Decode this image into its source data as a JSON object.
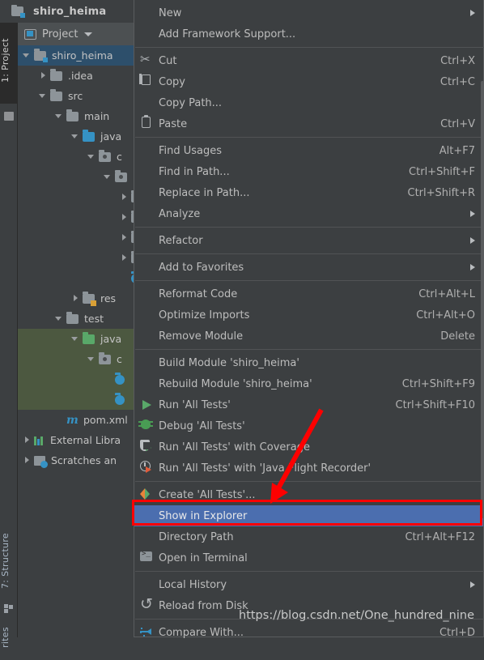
{
  "window": {
    "project_name": "shiro_heima",
    "project_icon": "module-folder-icon"
  },
  "toolstrip": {
    "tabs": [
      {
        "label": "1: Project",
        "active": true
      },
      {
        "label": "7: Structure",
        "active": false
      },
      {
        "label": "Favorites",
        "label_visible": "rites",
        "active": false
      }
    ]
  },
  "project_panel": {
    "header_label": "Project",
    "header_icon": "project-view-icon",
    "caret_icon": "chevron-down-icon",
    "tree": [
      {
        "label": "shiro_heima",
        "indent": 0,
        "twisty": "open",
        "icon": "module-folder-icon",
        "state": "selected-blue"
      },
      {
        "label": ".idea",
        "indent": 1,
        "twisty": "closed",
        "icon": "folder-icon",
        "state": ""
      },
      {
        "label": "src",
        "indent": 1,
        "twisty": "open",
        "icon": "folder-icon",
        "state": ""
      },
      {
        "label": "main",
        "indent": 2,
        "twisty": "open",
        "icon": "folder-icon",
        "state": ""
      },
      {
        "label": "java",
        "indent": 3,
        "twisty": "open",
        "icon": "source-folder-icon",
        "state": ""
      },
      {
        "label": "c",
        "indent": 4,
        "twisty": "open",
        "icon": "package-icon",
        "state": ""
      },
      {
        "label": "",
        "indent": 5,
        "twisty": "open",
        "icon": "package-icon",
        "state": ""
      },
      {
        "label": "",
        "indent": 6,
        "twisty": "closed",
        "icon": "package-icon",
        "state": ""
      },
      {
        "label": "",
        "indent": 6,
        "twisty": "closed",
        "icon": "package-icon",
        "state": ""
      },
      {
        "label": "",
        "indent": 6,
        "twisty": "closed",
        "icon": "package-icon",
        "state": ""
      },
      {
        "label": "",
        "indent": 6,
        "twisty": "closed",
        "icon": "package-icon",
        "state": ""
      },
      {
        "label": "",
        "indent": 6,
        "twisty": "none",
        "icon": "class-icon",
        "state": ""
      },
      {
        "label": "res",
        "indent": 3,
        "twisty": "closed",
        "icon": "resource-folder-icon",
        "state": ""
      },
      {
        "label": "test",
        "indent": 2,
        "twisty": "open",
        "icon": "folder-icon",
        "state": ""
      },
      {
        "label": "java",
        "indent": 3,
        "twisty": "open",
        "icon": "test-source-folder-icon",
        "state": "selected-green"
      },
      {
        "label": "c",
        "indent": 4,
        "twisty": "open",
        "icon": "package-icon",
        "state": "selected-green"
      },
      {
        "label": "",
        "indent": 5,
        "twisty": "none",
        "icon": "class-icon",
        "state": "selected-green"
      },
      {
        "label": "",
        "indent": 5,
        "twisty": "none",
        "icon": "class-icon",
        "state": "selected-green"
      },
      {
        "label": "pom.xml",
        "indent": 2,
        "twisty": "none",
        "icon": "maven-icon",
        "state": ""
      },
      {
        "label": "External Libra",
        "indent": 0,
        "twisty": "closed",
        "icon": "libraries-icon",
        "state": ""
      },
      {
        "label": "Scratches an",
        "indent": 0,
        "twisty": "closed",
        "icon": "scratches-icon",
        "state": ""
      }
    ]
  },
  "context_menu": {
    "items": [
      {
        "label": "New",
        "icon": "",
        "shortcut": "",
        "submenu": true,
        "highlighted": false,
        "mnemonic": "N"
      },
      {
        "label": "Add Framework Support...",
        "icon": "",
        "shortcut": "",
        "submenu": false,
        "highlighted": false
      },
      {
        "separator_after": true
      },
      {
        "label": "Cut",
        "icon": "cut-icon",
        "shortcut": "Ctrl+X",
        "submenu": false,
        "highlighted": false,
        "mnemonic": "t"
      },
      {
        "label": "Copy",
        "icon": "copy-icon",
        "shortcut": "Ctrl+C",
        "submenu": false,
        "highlighted": false,
        "mnemonic": "C"
      },
      {
        "label": "Copy Path...",
        "icon": "",
        "shortcut": "",
        "submenu": false,
        "highlighted": false
      },
      {
        "label": "Paste",
        "icon": "paste-icon",
        "shortcut": "Ctrl+V",
        "submenu": false,
        "highlighted": false,
        "mnemonic": "P"
      },
      {
        "separator_after": true
      },
      {
        "label": "Find Usages",
        "icon": "",
        "shortcut": "Alt+F7",
        "submenu": false,
        "highlighted": false,
        "mnemonic": "U"
      },
      {
        "label": "Find in Path...",
        "icon": "",
        "shortcut": "Ctrl+Shift+F",
        "submenu": false,
        "highlighted": false,
        "mnemonic": "P"
      },
      {
        "label": "Replace in Path...",
        "icon": "",
        "shortcut": "Ctrl+Shift+R",
        "submenu": false,
        "highlighted": false,
        "mnemonic": "a"
      },
      {
        "label": "Analyze",
        "icon": "",
        "shortcut": "",
        "submenu": true,
        "highlighted": false,
        "mnemonic": "z"
      },
      {
        "separator_after": true
      },
      {
        "label": "Refactor",
        "icon": "",
        "shortcut": "",
        "submenu": true,
        "highlighted": false,
        "mnemonic": "R"
      },
      {
        "separator_after": true
      },
      {
        "label": "Add to Favorites",
        "icon": "",
        "shortcut": "",
        "submenu": true,
        "highlighted": false,
        "mnemonic": "F"
      },
      {
        "separator_after": true
      },
      {
        "label": "Reformat Code",
        "icon": "",
        "shortcut": "Ctrl+Alt+L",
        "submenu": false,
        "highlighted": false,
        "mnemonic": "R"
      },
      {
        "label": "Optimize Imports",
        "icon": "",
        "shortcut": "Ctrl+Alt+O",
        "submenu": false,
        "highlighted": false,
        "mnemonic": "z"
      },
      {
        "label": "Remove Module",
        "icon": "",
        "shortcut": "Delete",
        "submenu": false,
        "highlighted": false
      },
      {
        "separator_after": true
      },
      {
        "label": "Build Module 'shiro_heima'",
        "icon": "",
        "shortcut": "",
        "submenu": false,
        "highlighted": false,
        "mnemonic": "M"
      },
      {
        "label": "Rebuild Module 'shiro_heima'",
        "icon": "",
        "shortcut": "Ctrl+Shift+F9",
        "submenu": false,
        "highlighted": false,
        "mnemonic": "e"
      },
      {
        "label": "Run 'All Tests'",
        "icon": "run-icon",
        "shortcut": "Ctrl+Shift+F10",
        "submenu": false,
        "highlighted": false,
        "mnemonic": "u"
      },
      {
        "label": "Debug 'All Tests'",
        "icon": "debug-icon",
        "shortcut": "",
        "submenu": false,
        "highlighted": false,
        "mnemonic": "D"
      },
      {
        "label": "Run 'All Tests' with Coverage",
        "icon": "coverage-icon",
        "shortcut": "",
        "submenu": false,
        "highlighted": false,
        "mnemonic": "v"
      },
      {
        "label": "Run 'All Tests' with 'Java Flight Recorder'",
        "icon": "jfr-icon",
        "shortcut": "",
        "submenu": false,
        "highlighted": false
      },
      {
        "separator_after": true
      },
      {
        "label": "Create 'All Tests'...",
        "icon": "create-test-icon",
        "shortcut": "",
        "submenu": false,
        "highlighted": false
      },
      {
        "label": "Show in Explorer",
        "icon": "",
        "shortcut": "",
        "submenu": false,
        "highlighted": true
      },
      {
        "label": "Directory Path",
        "icon": "",
        "shortcut": "Ctrl+Alt+F12",
        "submenu": false,
        "highlighted": false,
        "mnemonic": "a"
      },
      {
        "label": "Open in Terminal",
        "icon": "terminal-icon",
        "shortcut": "",
        "submenu": false,
        "highlighted": false
      },
      {
        "separator_after": true
      },
      {
        "label": "Local History",
        "icon": "",
        "shortcut": "",
        "submenu": true,
        "highlighted": false,
        "mnemonic": "H"
      },
      {
        "label": "Reload from Disk",
        "icon": "reload-icon",
        "shortcut": "",
        "submenu": false,
        "highlighted": false
      },
      {
        "separator_after": true
      },
      {
        "label": "Compare With...",
        "icon": "compare-icon",
        "shortcut": "Ctrl+D",
        "submenu": false,
        "highlighted": false
      }
    ]
  },
  "annotations": {
    "highlight_color": "#4b6eaf",
    "box_color": "#fe0000",
    "arrow_color": "#fe0000",
    "watermark_text": "https://blog.csdn.net/One_hundred_nine"
  }
}
